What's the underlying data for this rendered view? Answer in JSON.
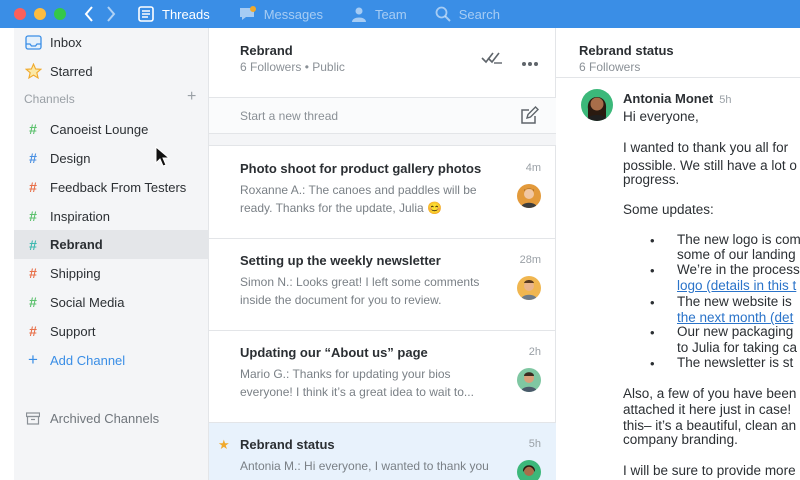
{
  "colors": {
    "accent": "#3a8ee6",
    "selected_row": "#e8f2fc",
    "star": "#f0a92b",
    "link": "#2a73c9"
  },
  "topnav": {
    "items": [
      {
        "label": "Threads",
        "icon": "threads-icon",
        "active": true
      },
      {
        "label": "Messages",
        "icon": "messages-icon",
        "active": false
      },
      {
        "label": "Team",
        "icon": "team-icon",
        "active": false
      },
      {
        "label": "Search",
        "icon": "search-icon",
        "active": false
      }
    ]
  },
  "sidebar": {
    "inbox": "Inbox",
    "starred": "Starred",
    "channels_label": "Channels",
    "channels": [
      {
        "label": "Canoeist Lounge",
        "color": "#5cc16e"
      },
      {
        "label": "Design",
        "color": "#4a90e2"
      },
      {
        "label": "Feedback From Testers",
        "color": "#e8704a"
      },
      {
        "label": "Inspiration",
        "color": "#5cc16e"
      },
      {
        "label": "Rebrand",
        "color": "#3fb9b0",
        "active": true
      },
      {
        "label": "Shipping",
        "color": "#e8704a"
      },
      {
        "label": "Social Media",
        "color": "#5cc16e"
      },
      {
        "label": "Support",
        "color": "#e8704a"
      }
    ],
    "add_channel": "Add Channel",
    "archived": "Archived Channels"
  },
  "thread_list": {
    "title": "Rebrand",
    "subtitle": "6 Followers • Public",
    "new_thread_placeholder": "Start a new thread",
    "threads": [
      {
        "title": "Photo shoot for product gallery photos",
        "time": "4m",
        "line1": "Roxanne A.: The canoes and paddles will be",
        "line2": "ready. Thanks for the update, Julia 😊"
      },
      {
        "title": "Setting up the weekly newsletter",
        "time": "28m",
        "line1": "Simon N.: Looks great! I left some comments",
        "line2": "inside the document for you to review."
      },
      {
        "title": "Updating our “About us” page",
        "time": "2h",
        "line1": "Mario G.: Thanks for updating your bios",
        "line2": "everyone! I think it’s a great idea to wait to..."
      },
      {
        "title": "Rebrand status",
        "time": "5h",
        "line1": "Antonia M.: Hi everyone, I wanted to thank you",
        "line2": "",
        "starred": true,
        "selected": true
      }
    ]
  },
  "message": {
    "title": "Rebrand status",
    "subtitle": "6 Followers",
    "author": "Antonia Monet",
    "time": "5h",
    "greeting": "Hi everyone,",
    "para1": [
      "I wanted to thank you all for",
      "possible. We still have a lot o",
      "progress."
    ],
    "updates_heading": "Some updates:",
    "bullets": [
      {
        "lines": [
          "The new logo is com",
          "some of our landing"
        ]
      },
      {
        "lines": [
          "We’re in the process",
          "logo (details in this t"
        ]
      },
      {
        "lines": [
          "The new website is",
          "the next month (det"
        ]
      },
      {
        "lines": [
          "Our new packaging",
          "to Julia for taking ca"
        ]
      },
      {
        "lines": [
          "The newsletter is st"
        ]
      }
    ],
    "para2": [
      "Also, a few of you have been",
      "attached it here just in case!",
      "this– it’s a beautiful, clean an",
      "company branding."
    ],
    "para3": "I will be sure to provide more"
  }
}
